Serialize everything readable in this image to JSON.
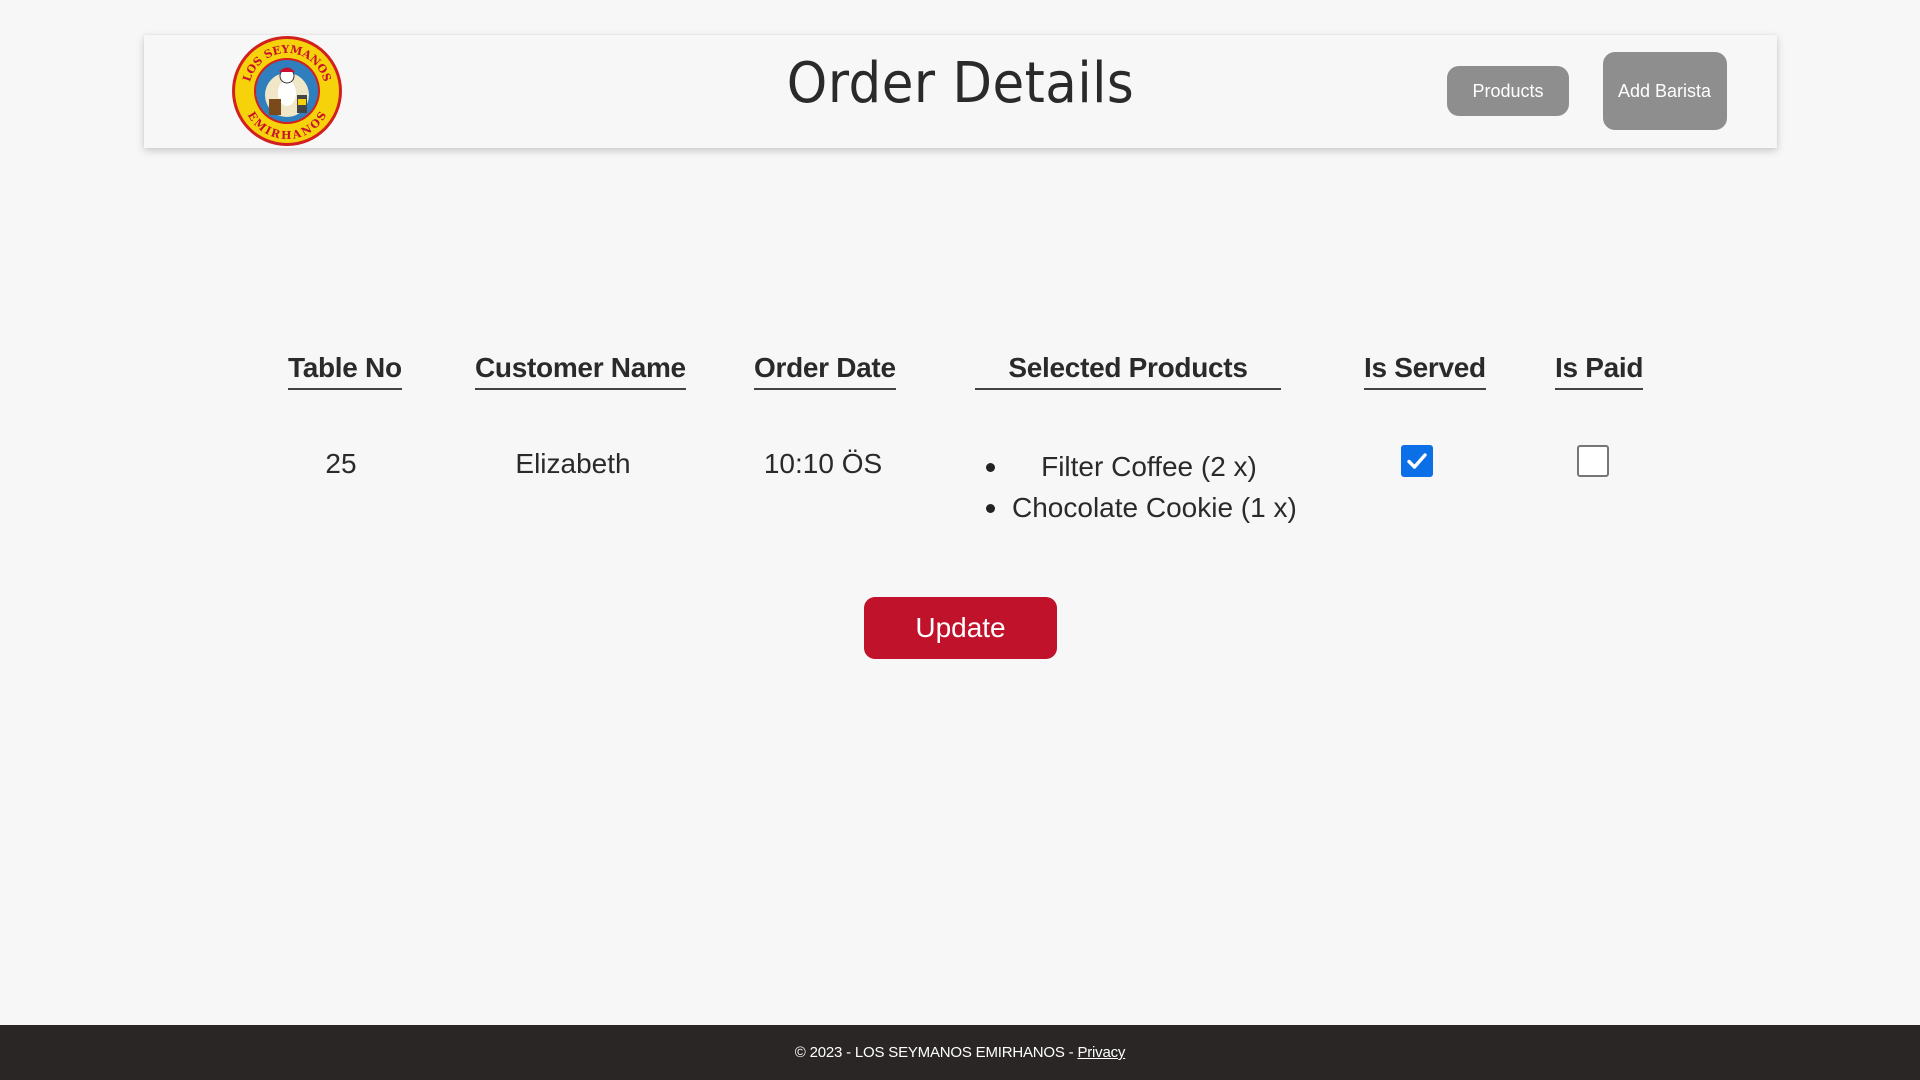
{
  "header": {
    "logo_text_top": "LOS SEYMANOS",
    "logo_text_bottom": "EMIRHANOS",
    "title": "Order Details",
    "nav": {
      "products_label": "Products",
      "add_barista_label": "Add Barista"
    }
  },
  "order_table": {
    "columns": [
      "Table No",
      "Customer Name",
      "Order Date",
      "Selected Products",
      "Is Served",
      "Is Paid"
    ],
    "row": {
      "table_no": "25",
      "customer_name": "Elizabeth",
      "order_date": "10:10 ÖS",
      "selected_products": [
        "Filter Coffee (2 x)",
        "Chocolate Cookie (1 x)"
      ],
      "is_served": true,
      "is_paid": false
    }
  },
  "actions": {
    "update_label": "Update"
  },
  "footer": {
    "copyright": "© 2023 - LOS SEYMANOS EMIRHANOS - ",
    "privacy_link": "Privacy"
  },
  "colors": {
    "background": "#f7f7f7",
    "nav_button": "#8e8e8e",
    "update_button": "#c0122b",
    "checkbox_checked": "#0b6fe8",
    "footer": "#2b2626",
    "logo_yellow": "#f5d20a",
    "logo_red": "#d21f1f"
  }
}
